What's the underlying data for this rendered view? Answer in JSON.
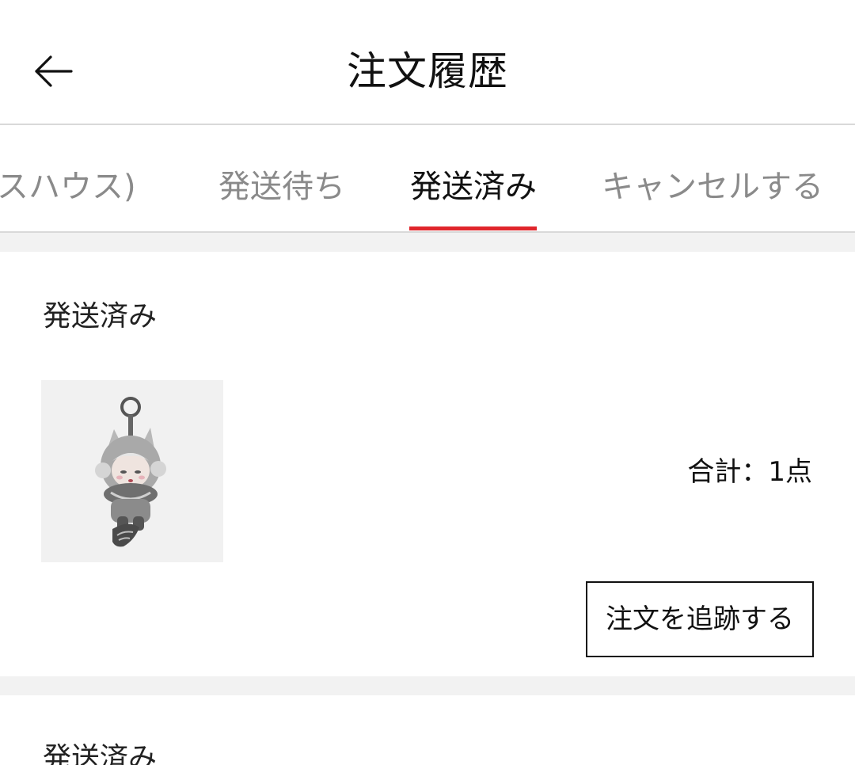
{
  "header": {
    "title": "注文履歴",
    "back_icon": "arrow-left-icon"
  },
  "tabs": [
    {
      "label": "スハウス)",
      "active": false
    },
    {
      "label": "発送待ち",
      "active": false
    },
    {
      "label": "発送済み",
      "active": true
    },
    {
      "label": "キャンセルする",
      "active": false
    }
  ],
  "accent_color": "#e0252b",
  "orders": [
    {
      "status": "発送済み",
      "total_label": "合計：",
      "total_count": "1点",
      "track_button": "注文を追跡する"
    },
    {
      "status": "発送済み"
    }
  ]
}
